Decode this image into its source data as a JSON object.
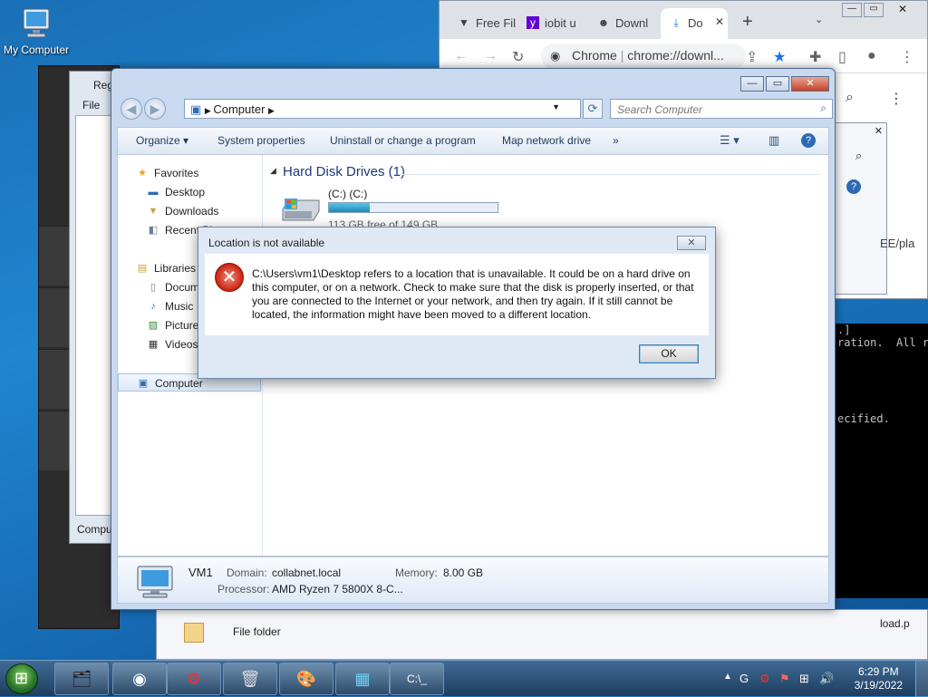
{
  "desktop": {
    "icon_label": "My Computer"
  },
  "registry_window": {
    "title": "Reg",
    "menu_file": "File",
    "status": "Compu"
  },
  "chrome": {
    "tabs": [
      {
        "label": "Free Fil",
        "icon": "vpn-icon"
      },
      {
        "label": "iobit u",
        "icon": "yahoo-icon"
      },
      {
        "label": "Downl",
        "icon": "android-icon"
      },
      {
        "label": "Do",
        "icon": "download-icon"
      }
    ],
    "omnibox_prefix": "Chrome",
    "omnibox_url": "chrome://downl...",
    "partial_text": "EE/pla"
  },
  "console": {
    "lines": [
      ".]",
      "ration.  All r",
      "ecified."
    ]
  },
  "explorer": {
    "address": "Computer",
    "search_placeholder": "Search Computer",
    "commands": {
      "organize": "Organize",
      "system_properties": "System properties",
      "uninstall": "Uninstall or change a program",
      "map_drive": "Map network drive",
      "more": "»"
    },
    "nav": {
      "favorites": "Favorites",
      "desktop": "Desktop",
      "downloads": "Downloads",
      "recent": "Recent Pl",
      "libraries": "Libraries",
      "documents": "Docum",
      "music": "Music",
      "pictures": "Picture",
      "videos": "Videos",
      "computer": "Computer"
    },
    "section": "Hard Disk Drives (1)",
    "drive": {
      "name": "(C:) (C:)",
      "free_text": "113 GB free of 149 GB",
      "used_fraction": 0.2416
    },
    "details": {
      "name": "VM1",
      "domain_label": "Domain:",
      "domain": "collabnet.local",
      "memory_label": "Memory:",
      "memory": "8.00 GB",
      "processor_label": "Processor:",
      "processor": "AMD Ryzen 7 5800X 8-C..."
    }
  },
  "second_explorer": {
    "row_type": "File folder",
    "partial": "load.p"
  },
  "dialog": {
    "title": "Location is not available",
    "message": "C:\\Users\\vm1\\Desktop refers to a location that is unavailable. It could be on a hard drive on this computer, or on a network. Check to make sure that the disk is properly inserted, or that you are connected to the Internet or your network, and then try again. If it still cannot be located, the information might have been moved to a different location.",
    "ok": "OK",
    "close_glyph": "✕"
  },
  "taskbar": {
    "apps": [
      "explorer-app-icon",
      "chrome-app-icon",
      "iobit-app-icon",
      "recycle-app-icon",
      "paint-app-icon",
      "registry-app-icon",
      "cmd-app-icon"
    ],
    "time": "6:29 PM",
    "date": "3/19/2022"
  },
  "colors": {
    "desktop_blue": "#1f86d0",
    "error_red": "#c8220f",
    "drive_bar": "#1c8ab8"
  }
}
